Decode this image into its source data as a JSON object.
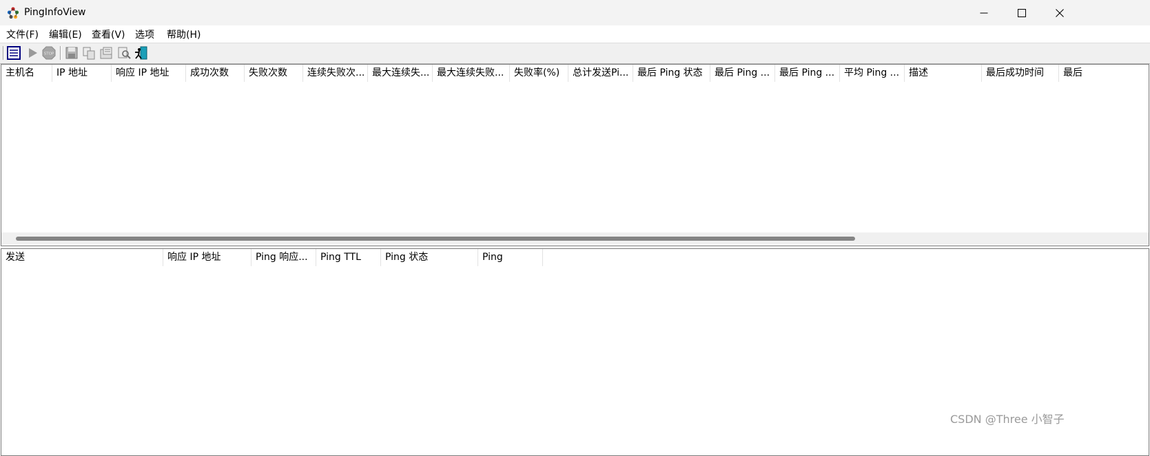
{
  "window": {
    "title": "PingInfoView"
  },
  "menu": [
    {
      "label": "文件(F)"
    },
    {
      "label": "编辑(E)"
    },
    {
      "label": "查看(V)"
    },
    {
      "label": "选项"
    },
    {
      "label": "帮助(H)"
    }
  ],
  "toolbar": {
    "icons": [
      "properties-icon",
      "start-icon",
      "stop-icon",
      "save-icon",
      "copy-icon",
      "options-icon",
      "find-icon",
      "exit-icon"
    ]
  },
  "top_table": {
    "columns": [
      {
        "label": "主机名"
      },
      {
        "label": "IP 地址"
      },
      {
        "label": "响应 IP 地址"
      },
      {
        "label": "成功次数"
      },
      {
        "label": "失败次数"
      },
      {
        "label": "连续失败次..."
      },
      {
        "label": "最大连续失..."
      },
      {
        "label": "最大连续失败..."
      },
      {
        "label": "失败率(%)"
      },
      {
        "label": "总计发送Pi..."
      },
      {
        "label": "最后 Ping 状态"
      },
      {
        "label": "最后 Ping ..."
      },
      {
        "label": "最后 Ping ..."
      },
      {
        "label": "平均 Ping ..."
      },
      {
        "label": "描述"
      },
      {
        "label": "最后成功时间"
      },
      {
        "label": "最后"
      }
    ]
  },
  "bottom_table": {
    "columns": [
      {
        "label": "发送"
      },
      {
        "label": "响应 IP 地址"
      },
      {
        "label": "Ping 响应..."
      },
      {
        "label": "Ping TTL"
      },
      {
        "label": "Ping 状态"
      },
      {
        "label": "Ping"
      }
    ]
  },
  "watermark": "CSDN @Three 小智子",
  "colors": {
    "titlebar": "#f3f3f3",
    "toolbar": "#f0f0f0",
    "scroll_thumb": "#858585"
  }
}
